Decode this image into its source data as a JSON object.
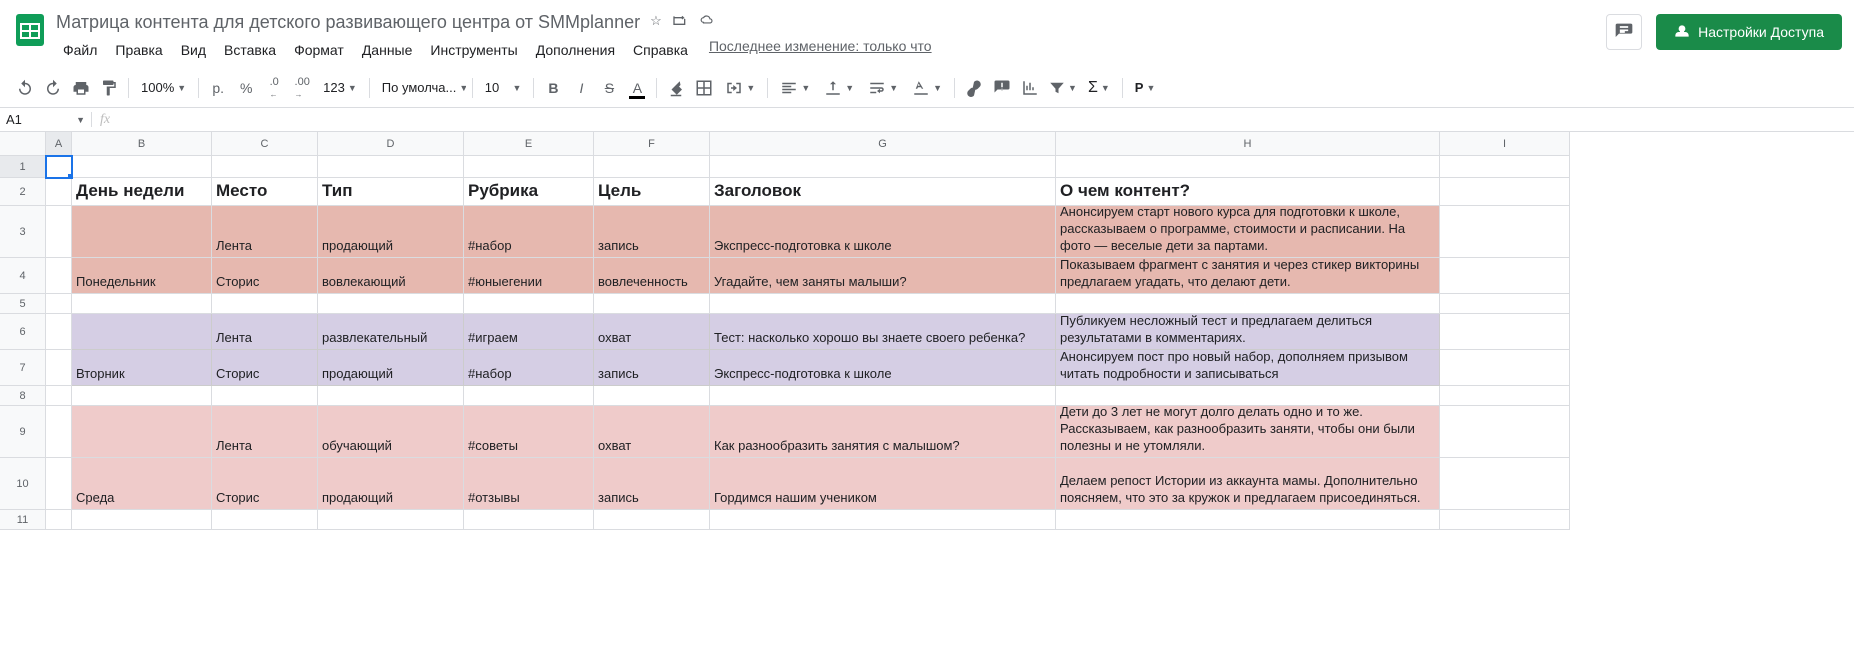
{
  "header": {
    "title": "Матрица контента для детского развивающего центра от SMMplanner",
    "menus": [
      "Файл",
      "Правка",
      "Вид",
      "Вставка",
      "Формат",
      "Данные",
      "Инструменты",
      "Дополнения",
      "Справка"
    ],
    "last_edit": "Последнее изменение: только что",
    "share_label": "Настройки Доступа"
  },
  "toolbar": {
    "zoom": "100%",
    "currency": "р.",
    "percent": "%",
    "dec_minus": ".0",
    "dec_plus": ".00",
    "format_more": "123",
    "font": "По умолча...",
    "font_size": "10"
  },
  "name_box": "A1",
  "columns": [
    "A",
    "B",
    "C",
    "D",
    "E",
    "F",
    "G",
    "H",
    "I"
  ],
  "headers_row": [
    "День недели",
    "Место",
    "Тип",
    "Рубрика",
    "Цель",
    "Заголовок",
    "О чем контент?"
  ],
  "rows": {
    "r3": {
      "C": "Лента",
      "D": "продающий",
      "E": "#набор",
      "F": "запись",
      "G": "Экспресс-подготовка к школе",
      "H": "Анонсируем старт нового курса для подготовки к школе, рассказываем о программе, стоимости и расписании. На фото — веселые дети за партами."
    },
    "r4": {
      "B": "Понедельник",
      "C": "Сторис",
      "D": "вовлекающий",
      "E": "#юныегении",
      "F": "вовлеченность",
      "G": "Угадайте, чем заняты малыши?",
      "H": "Показываем фрагмент с занятия и через стикер викторины предлагаем угадать, что делают дети."
    },
    "r6": {
      "C": "Лента",
      "D": "развлекательный",
      "E": "#играем",
      "F": "охват",
      "G": "Тест: насколько хорошо вы знаете своего ребенка?",
      "H": "Публикуем несложный тест и предлагаем делиться результатами в комментариях."
    },
    "r7": {
      "B": "Вторник",
      "C": "Сторис",
      "D": "продающий",
      "E": "#набор",
      "F": "запись",
      "G": "Экспресс-подготовка к школе",
      "H": "Анонсируем пост про новый набор, дополняем призывом читать подробности и записываться"
    },
    "r9": {
      "C": "Лента",
      "D": "обучающий",
      "E": "#советы",
      "F": "охват",
      "G": "Как разнообразить занятия с малышом?",
      "H": "Дети до 3 лет не могут долго делать одно и то же. Рассказываем, как разнообразить заняти, чтобы они были полезны и не утомляли."
    },
    "r10": {
      "B": "Среда",
      "C": "Сторис",
      "D": "продающий",
      "E": "#отзывы",
      "F": "запись",
      "G": "Гордимся нашим учеником",
      "H": "Делаем репост Истории из аккаунта мамы. Дополнительно поясняем, что это за кружок и предлагаем присоединяться."
    }
  }
}
